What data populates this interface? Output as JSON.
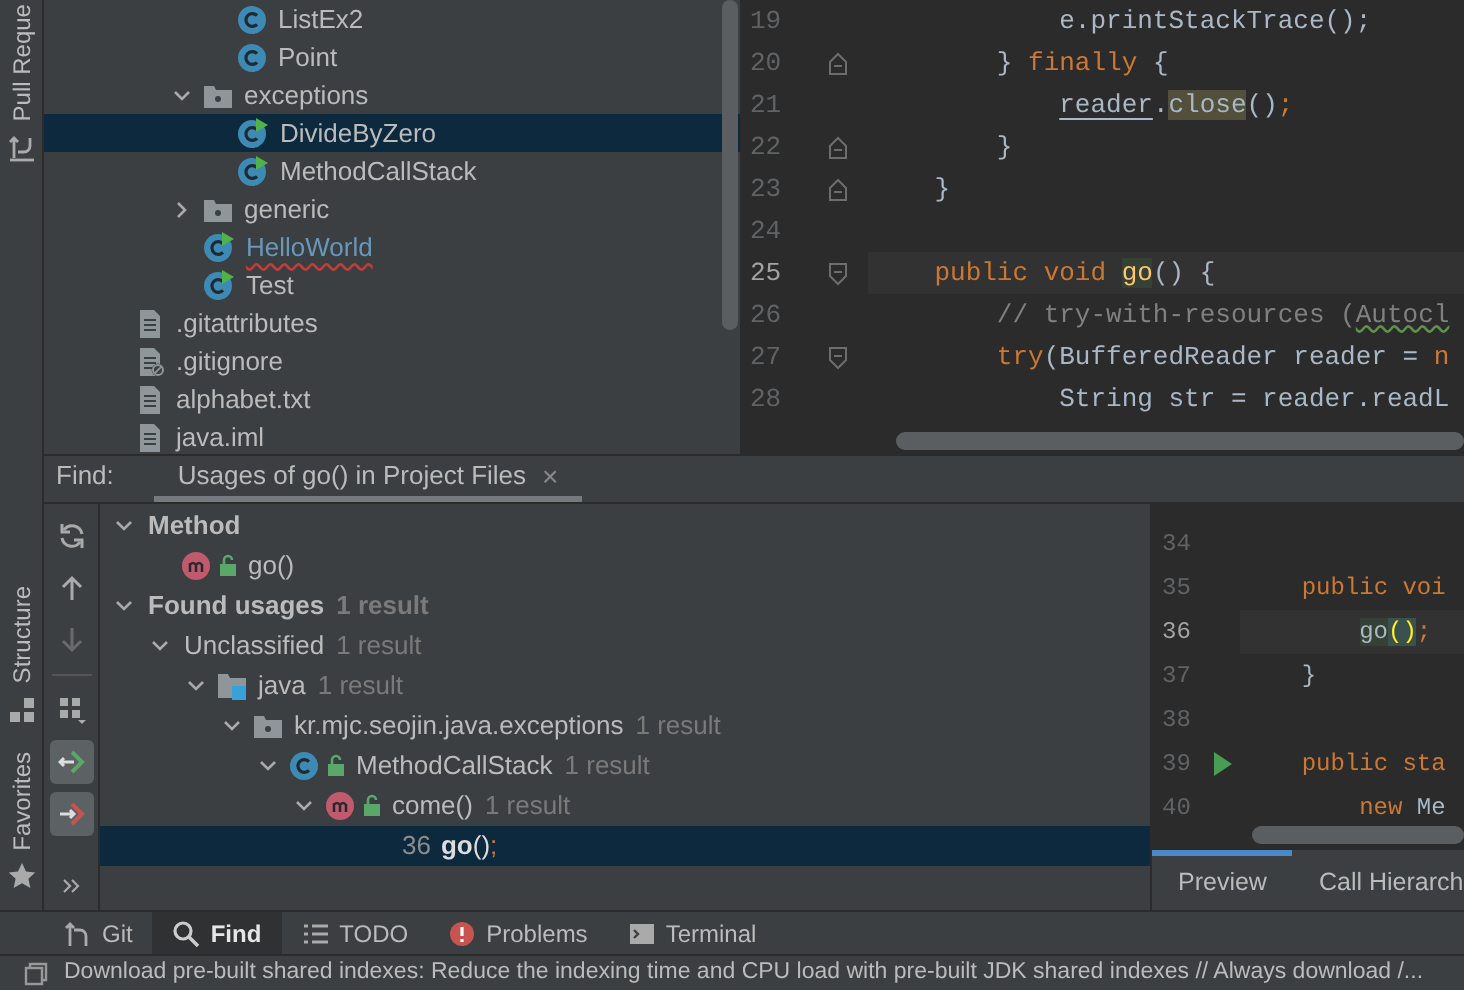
{
  "side_stripe": [
    {
      "label": "Pull Reque"
    },
    {
      "label": "Structure"
    },
    {
      "label": "Favorites"
    }
  ],
  "project_tree": [
    {
      "children": [
        {
          "children": [
            {
              "children": [
                {
                  "kind": "class",
                  "label": "ListEx2"
                },
                {
                  "kind": "class",
                  "label": "Point"
                }
              ]
            },
            {
              "kind": "package",
              "label": "exceptions",
              "expanded": true,
              "children": [
                {
                  "kind": "runnable_class",
                  "label": "DivideByZero",
                  "selected": true
                },
                {
                  "kind": "runnable_class",
                  "label": "MethodCallStack"
                }
              ]
            },
            {
              "kind": "package",
              "label": "generic",
              "expanded": false
            },
            {
              "kind": "runnable_class",
              "label": "HelloWorld",
              "modified": true,
              "error": true
            },
            {
              "kind": "runnable_class",
              "label": "Test"
            }
          ]
        }
      ]
    },
    {
      "kind": "file",
      "label": ".gitattributes"
    },
    {
      "kind": "ignored_file",
      "label": ".gitignore"
    },
    {
      "kind": "file",
      "label": "alphabet.txt"
    },
    {
      "kind": "file",
      "label": "java.iml"
    }
  ],
  "editor": {
    "lines": [
      {
        "number": "19",
        "tokens": [
          {
            "kind": "plain",
            "text": "            e.printStackTrace();"
          }
        ]
      },
      {
        "number": "20",
        "fold_end": true,
        "tokens": [
          {
            "kind": "plain",
            "text": "        } "
          },
          {
            "kind": "keyword",
            "text": "finally"
          },
          {
            "kind": "plain",
            "text": " {"
          }
        ]
      },
      {
        "number": "21",
        "tokens": [
          {
            "kind": "under",
            "text": "            reader"
          },
          {
            "kind": "plain",
            "text": "."
          },
          {
            "kind": "hit",
            "text": "close"
          },
          {
            "kind": "plain",
            "text": "()"
          },
          {
            "kind": "keyword",
            "text": ";"
          }
        ]
      },
      {
        "number": "22",
        "fold_end": true,
        "tokens": [
          {
            "kind": "plain",
            "text": "        }"
          }
        ]
      },
      {
        "number": "23",
        "fold_end": true,
        "tokens": [
          {
            "kind": "plain",
            "text": "    }"
          }
        ]
      },
      {
        "number": "24"
      },
      {
        "number": "25",
        "fold_start": true,
        "current": true,
        "tokens": [
          {
            "kind": "keyword",
            "text": "    public void "
          },
          {
            "kind": "decl",
            "text": "go"
          },
          {
            "kind": "plain",
            "text": "() {"
          }
        ]
      },
      {
        "number": "26",
        "tokens": [
          {
            "kind": "comment",
            "text": "        // try-with-resources ("
          },
          {
            "kind": "squiggle",
            "text": "Autocl"
          }
        ]
      },
      {
        "number": "27",
        "fold_start": true,
        "tokens": [
          {
            "kind": "keyword",
            "text": "        try"
          },
          {
            "kind": "plain",
            "text": "(BufferedReader reader = "
          },
          {
            "kind": "keyword",
            "text": "n"
          }
        ]
      },
      {
        "number": "28",
        "tokens": [
          {
            "kind": "plain",
            "text": "            String str = reader.readL"
          }
        ]
      }
    ]
  },
  "find": {
    "label": "Find:",
    "tab": {
      "label": "Usages of go() in Project Files",
      "close": "×",
      "selected": true
    },
    "toolbar": [
      {
        "disabled": false
      },
      {
        "disabled": false
      },
      {
        "disabled": true
      },
      {
        "pressed": false
      },
      {
        "pressed": true
      },
      {
        "pressed": true
      }
    ],
    "results": [
      {
        "kind": "group",
        "label": "Method",
        "expanded": true,
        "children": [
          {
            "kind": "method",
            "label": "go()"
          }
        ]
      },
      {
        "kind": "group",
        "label": "Found usages",
        "count": "1 result",
        "expanded": true,
        "children": [
          {
            "kind": "plain",
            "label": "Unclassified",
            "count": "1 result",
            "expanded": true,
            "children": [
              {
                "kind": "source_root",
                "label": "java",
                "count": "1 result",
                "expanded": true,
                "children": [
                  {
                    "kind": "package",
                    "label": "kr.mjc.seojin.java.exceptions",
                    "count": "1 result",
                    "expanded": true,
                    "children": [
                      {
                        "kind": "class",
                        "label": "MethodCallStack",
                        "count": "1 result",
                        "expanded": true,
                        "children": [
                          {
                            "kind": "method",
                            "label": "come()",
                            "count": "1 result",
                            "expanded": true,
                            "children": [
                              {
                                "kind": "usage",
                                "line": "36",
                                "tokens": [
                                  {
                                    "kind": "bold",
                                    "text": "go"
                                  },
                                  {
                                    "kind": "plain",
                                    "text": "()"
                                  },
                                  {
                                    "kind": "keyword",
                                    "text": ";"
                                  }
                                ],
                                "selected": true
                              }
                            ]
                          }
                        ]
                      }
                    ]
                  }
                ]
              }
            ]
          }
        ]
      }
    ],
    "preview": {
      "lines": [
        {
          "number": "34"
        },
        {
          "number": "35",
          "tokens": [
            {
              "kind": "keyword",
              "text": "    public voi"
            }
          ]
        },
        {
          "number": "36",
          "current": true,
          "tokens": [
            {
              "kind": "hit2",
              "text": "        go"
            },
            {
              "kind": "paren",
              "text": "()"
            },
            {
              "kind": "keyword",
              "text": ";"
            }
          ]
        },
        {
          "number": "37",
          "tokens": [
            {
              "kind": "plain",
              "text": "    }"
            }
          ]
        },
        {
          "number": "38"
        },
        {
          "number": "39",
          "run": true,
          "tokens": [
            {
              "kind": "keyword",
              "text": "    public sta"
            }
          ]
        },
        {
          "number": "40",
          "tokens": [
            {
              "kind": "keyword",
              "text": "        new"
            },
            {
              "kind": "plain",
              "text": " Me"
            }
          ]
        }
      ],
      "tabs": [
        {
          "label": "Preview",
          "selected": true
        },
        {
          "label": "Call Hierarch",
          "selected": false
        }
      ]
    }
  },
  "bottom_tabs": [
    {
      "kind": "git",
      "label": "Git",
      "selected": false
    },
    {
      "kind": "search",
      "label": "Find",
      "selected": true
    },
    {
      "kind": "list",
      "label": "TODO",
      "selected": false
    },
    {
      "kind": "problems",
      "label": "Problems",
      "selected": false
    },
    {
      "kind": "terminal",
      "label": "Terminal",
      "selected": false
    }
  ],
  "status_bar": {
    "message": "Download pre-built shared indexes: Reduce the indexing time and CPU load with pre-built JDK shared indexes // Always download /..."
  }
}
